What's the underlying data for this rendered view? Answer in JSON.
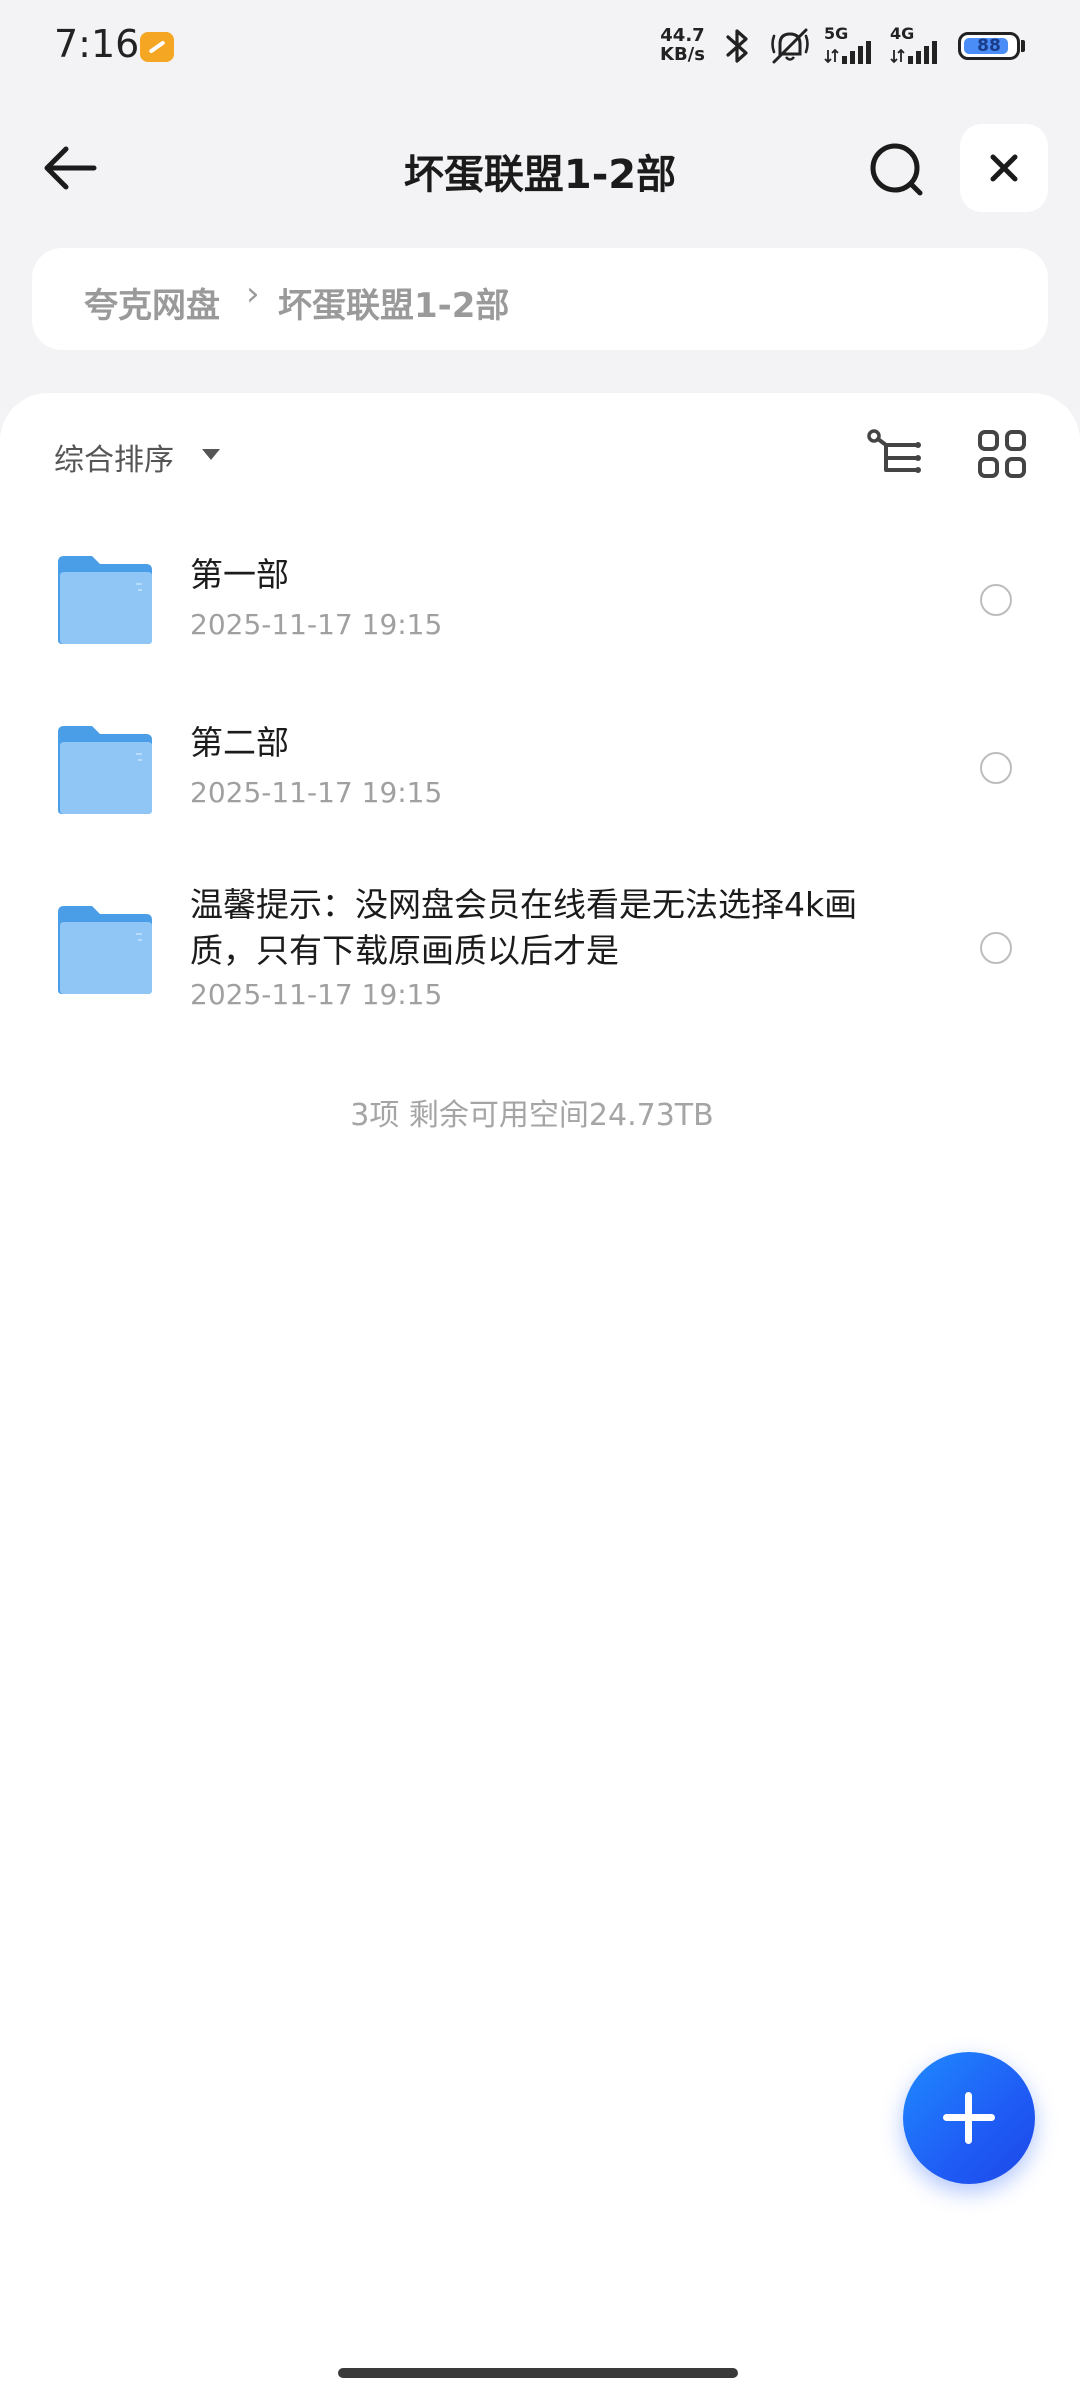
{
  "status_bar": {
    "time": "7:16",
    "net_speed_value": "44.7",
    "net_speed_unit": "KB/s",
    "signal_5g": "5G",
    "signal_4g": "4G",
    "battery_level": 88,
    "battery_text": "88",
    "icons": [
      "bluetooth-icon",
      "mute-icon",
      "signal-icon",
      "battery-icon"
    ]
  },
  "header": {
    "title": "坏蛋联盟1-2部",
    "back_icon": "arrow-left-icon",
    "search_icon": "search-icon",
    "close_icon": "close-icon"
  },
  "breadcrumb": {
    "items": [
      "夸克网盘",
      "坏蛋联盟1-2部"
    ],
    "separator": "›"
  },
  "toolbar": {
    "sort_label": "综合排序",
    "sort_icon": "caret-down-icon",
    "tree_icon": "tree-view-icon",
    "grid_icon": "grid-view-icon"
  },
  "files": [
    {
      "name": "第一部",
      "date": "2025-11-17 19:15",
      "type": "folder"
    },
    {
      "name": "第二部",
      "date": "2025-11-17 19:15",
      "type": "folder"
    },
    {
      "name_line1": "温馨提示：没网盘会员在线看是无法选择4k画",
      "name_line2": "质，只有下载原画质以后才是",
      "date": "2025-11-17 19:15",
      "type": "folder"
    }
  ],
  "footer": {
    "summary": "3项 剩余可用空间24.73TB"
  },
  "fab": {
    "icon": "plus-icon"
  },
  "colors": {
    "accent": "#1f5cf5",
    "folder": "#5aaaf0",
    "background": "#f3f3f5"
  }
}
